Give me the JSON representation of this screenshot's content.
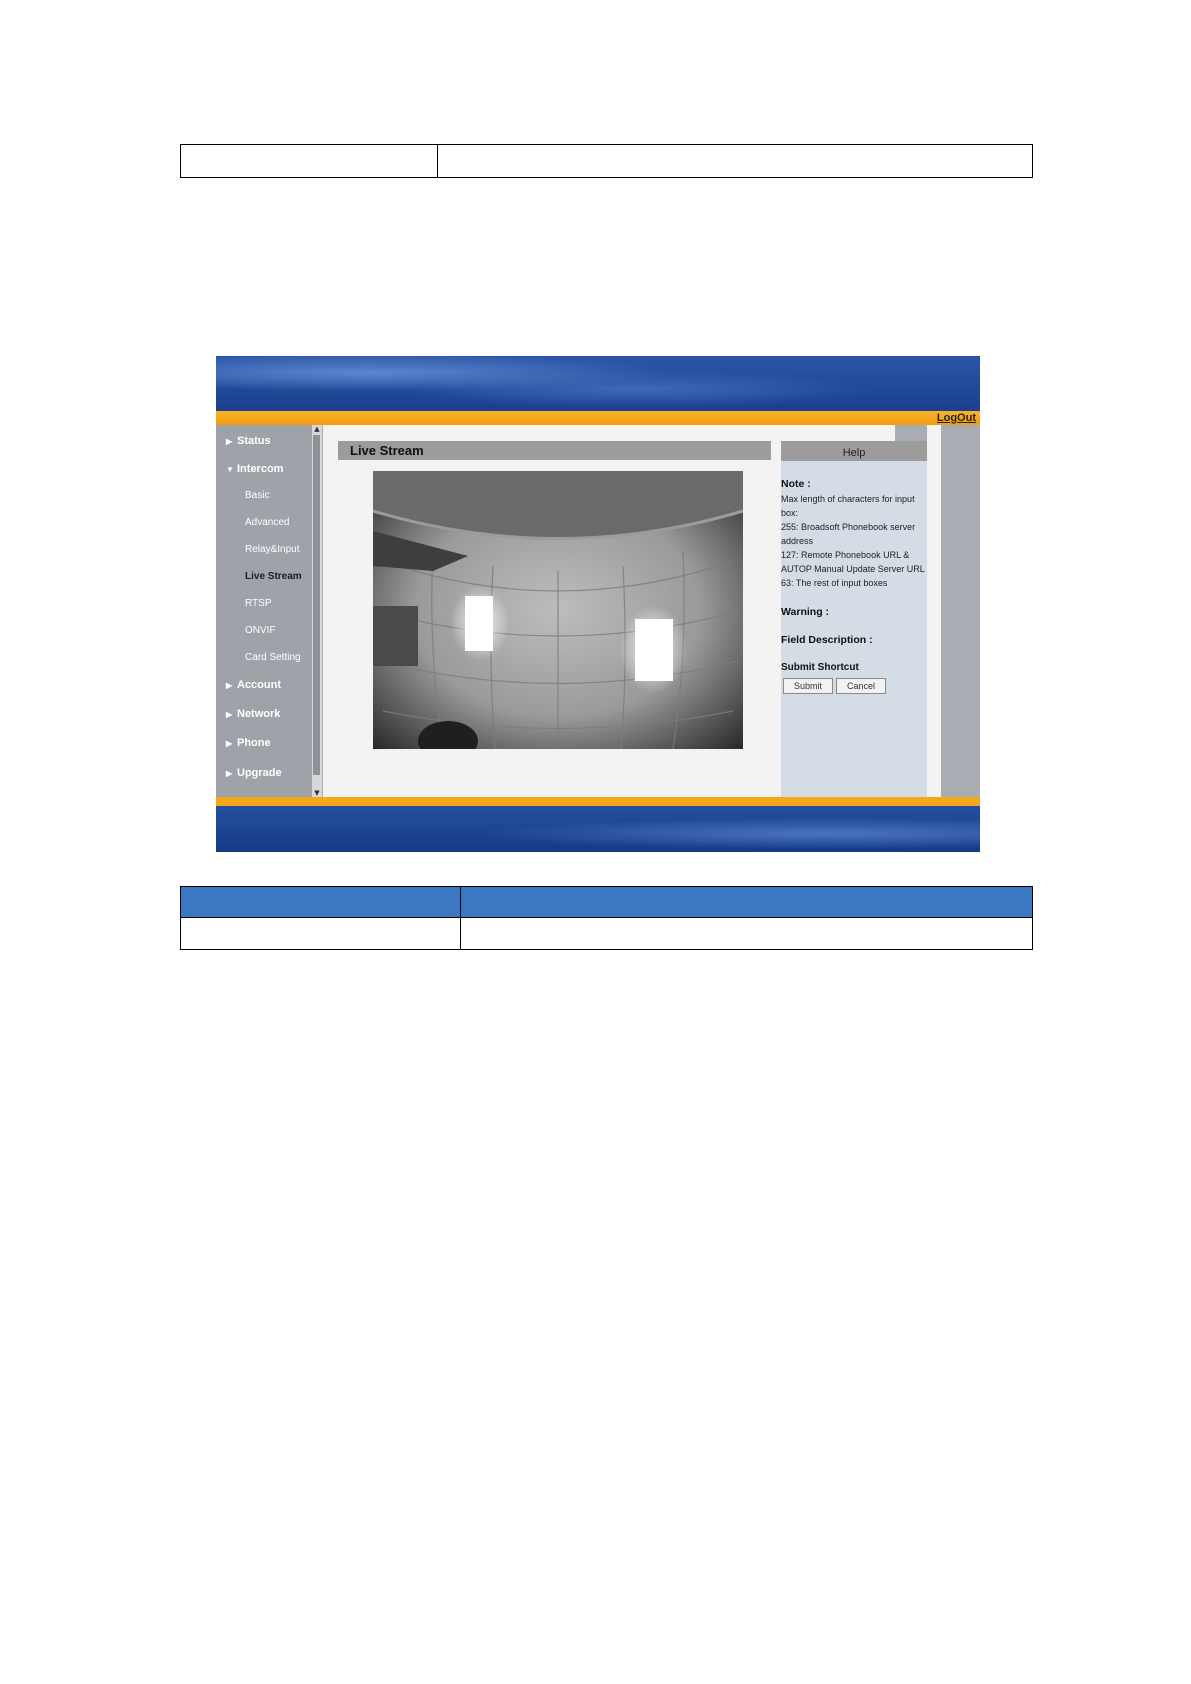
{
  "header": {
    "logout_label": "LogOut"
  },
  "sidebar": {
    "items": [
      {
        "label": "Status",
        "expanded": false
      },
      {
        "label": "Intercom",
        "expanded": true
      },
      {
        "label": "Account",
        "expanded": false
      },
      {
        "label": "Network",
        "expanded": false
      },
      {
        "label": "Phone",
        "expanded": false
      },
      {
        "label": "Upgrade",
        "expanded": false
      }
    ],
    "subitems": [
      {
        "label": "Basic"
      },
      {
        "label": "Advanced"
      },
      {
        "label": "Relay&Input"
      },
      {
        "label": "Live Stream",
        "active": true
      },
      {
        "label": "RTSP"
      },
      {
        "label": "ONVIF"
      },
      {
        "label": "Card Setting"
      }
    ]
  },
  "main": {
    "title": "Live Stream"
  },
  "help": {
    "title": "Help",
    "note_heading": "Note :",
    "note_lines": [
      "Max length of characters for input",
      "box:",
      "255: Broadsoft Phonebook server",
      "address",
      "127: Remote Phonebook URL &",
      "AUTOP Manual Update Server URL",
      "63: The rest of input boxes"
    ],
    "warning_heading": "Warning :",
    "field_heading": "Field Description :",
    "shortcut_heading": "Submit Shortcut",
    "submit_label": "Submit",
    "cancel_label": "Cancel"
  },
  "colors": {
    "banner_blue": "#1b3f8e",
    "accent_orange": "#f5a81a",
    "table_header_blue": "#3a78c3"
  }
}
